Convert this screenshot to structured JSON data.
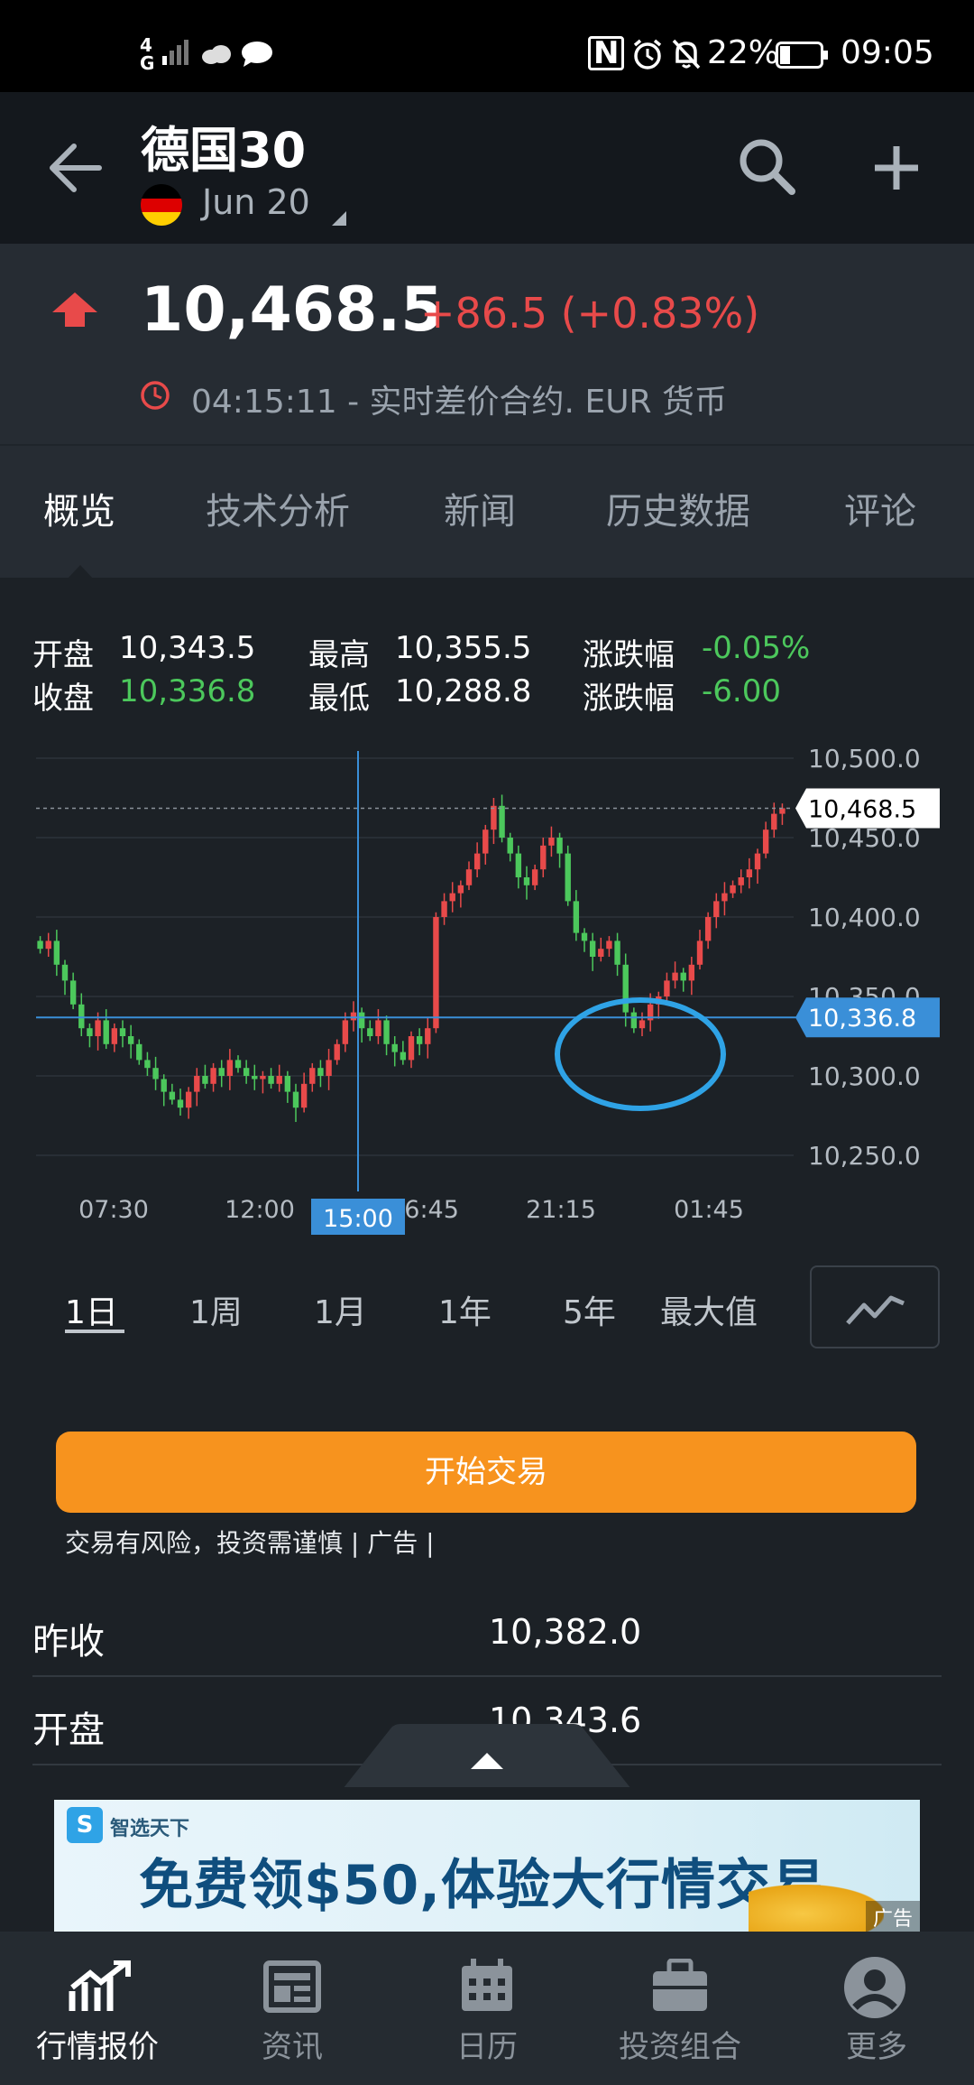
{
  "status_bar": {
    "network": "4G",
    "battery": "22%",
    "time": "09:05"
  },
  "header": {
    "title": "德国30",
    "contract": "Jun 20"
  },
  "price": {
    "last": "10,468.5",
    "change": "+86.5 (+0.83%)",
    "meta": "04:15:11 - 实时差价合约. EUR 货币"
  },
  "tabs": [
    "概览",
    "技术分析",
    "新闻",
    "历史数据",
    "评论"
  ],
  "stats": {
    "open_label": "开盘",
    "open_value": "10,343.5",
    "close_label": "收盘",
    "close_value": "10,336.8",
    "high_label": "最高",
    "high_value": "10,355.5",
    "low_label": "最低",
    "low_value": "10,288.8",
    "chg_pct_label": "涨跌幅",
    "chg_pct_value": "-0.05%",
    "chg_label": "涨跌幅",
    "chg_value": "-6.00"
  },
  "chart_data": {
    "type": "candlestick",
    "y_ticks": [
      "10,500.0",
      "10,450.0",
      "10,400.0",
      "10,350.0",
      "10,300.0",
      "10,250.0"
    ],
    "ylim": [
      10250,
      10500
    ],
    "x_ticks": [
      "07:30",
      "12:00",
      "15:00",
      "16:45",
      "21:15",
      "01:45"
    ],
    "last_price_label": "10,468.5",
    "crosshair_price_label": "10,336.8",
    "crosshair_time_label": "15:00",
    "last_price": 10468.5,
    "crosshair_price": 10336.8,
    "closes": [
      10380,
      10385,
      10370,
      10360,
      10345,
      10330,
      10325,
      10335,
      10320,
      10330,
      10325,
      10320,
      10310,
      10305,
      10298,
      10290,
      10285,
      10280,
      10290,
      10300,
      10295,
      10305,
      10300,
      10310,
      10305,
      10300,
      10298,
      10300,
      10295,
      10300,
      10290,
      10280,
      10295,
      10305,
      10300,
      10310,
      10320,
      10335,
      10340,
      10330,
      10325,
      10335,
      10320,
      10315,
      10310,
      10325,
      10320,
      10330,
      10400,
      10410,
      10415,
      10420,
      10430,
      10440,
      10455,
      10470,
      10450,
      10440,
      10425,
      10420,
      10430,
      10445,
      10450,
      10440,
      10410,
      10390,
      10385,
      10375,
      10380,
      10385,
      10370,
      10340,
      10330,
      10335,
      10345,
      10350,
      10360,
      10365,
      10360,
      10370,
      10385,
      10400,
      10410,
      10415,
      10420,
      10425,
      10430,
      10440,
      10455,
      10465,
      10468.5
    ],
    "colors": {
      "up": "#e84a4a",
      "down": "#4cc85c",
      "crosshair": "#3a8fd8",
      "annotation": "#2fa3e6"
    }
  },
  "ranges": [
    "1日",
    "1周",
    "1月",
    "1年",
    "5年",
    "最大值"
  ],
  "trade": {
    "button": "开始交易",
    "disclaimer": "交易有风险，投资需谨慎 | 广告 |"
  },
  "details": [
    {
      "label": "昨收",
      "value": "10,382.0"
    },
    {
      "label": "开盘",
      "value": "10,343.6"
    }
  ],
  "ad": {
    "brand": "智选天下",
    "text": "免费领$50,体验大行情交易",
    "tag": "广告"
  },
  "bottom_nav": [
    "行情报价",
    "资讯",
    "日历",
    "投资组合",
    "更多"
  ]
}
